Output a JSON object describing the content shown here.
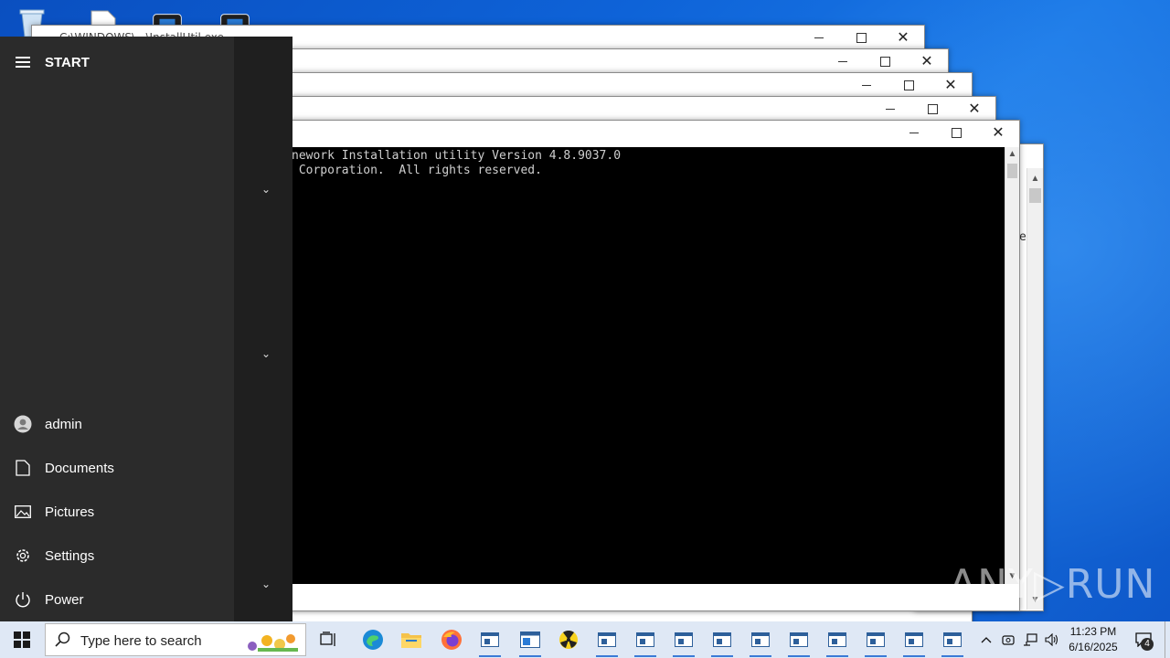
{
  "desktop": {
    "icons": [
      "recycle-bin-icon",
      "file-icon",
      "app-icon",
      "app-icon"
    ]
  },
  "windows": [
    {
      "title": "C:\\WINDOWS\\...\\InstallUtil.exe"
    },
    {
      "title": ""
    },
    {
      "title": ""
    },
    {
      "title": ""
    },
    {
      "title": ""
    }
  ],
  "console": {
    "lines": [
      "nework Installation utility Version 4.8.9037.0",
      " Corporation.  All rights reserved."
    ],
    "side_char": "e"
  },
  "start_menu": {
    "title": "START",
    "items": [
      {
        "label": "admin",
        "icon": "user-icon"
      },
      {
        "label": "Documents",
        "icon": "document-icon"
      },
      {
        "label": "Pictures",
        "icon": "pictures-icon"
      },
      {
        "label": "Settings",
        "icon": "gear-icon"
      },
      {
        "label": "Power",
        "icon": "power-icon"
      }
    ]
  },
  "taskbar": {
    "search_placeholder": "Type here to search",
    "clock_time": "11:23 PM",
    "clock_date": "6/16/2025",
    "notification_count": "4"
  },
  "watermark": "ANY▷RUN",
  "colors": {
    "desktop": "#0e63d8",
    "start_menu": "#2b2b2b",
    "taskbar": "#dfe8f5",
    "accent": "#3b7ad6"
  }
}
